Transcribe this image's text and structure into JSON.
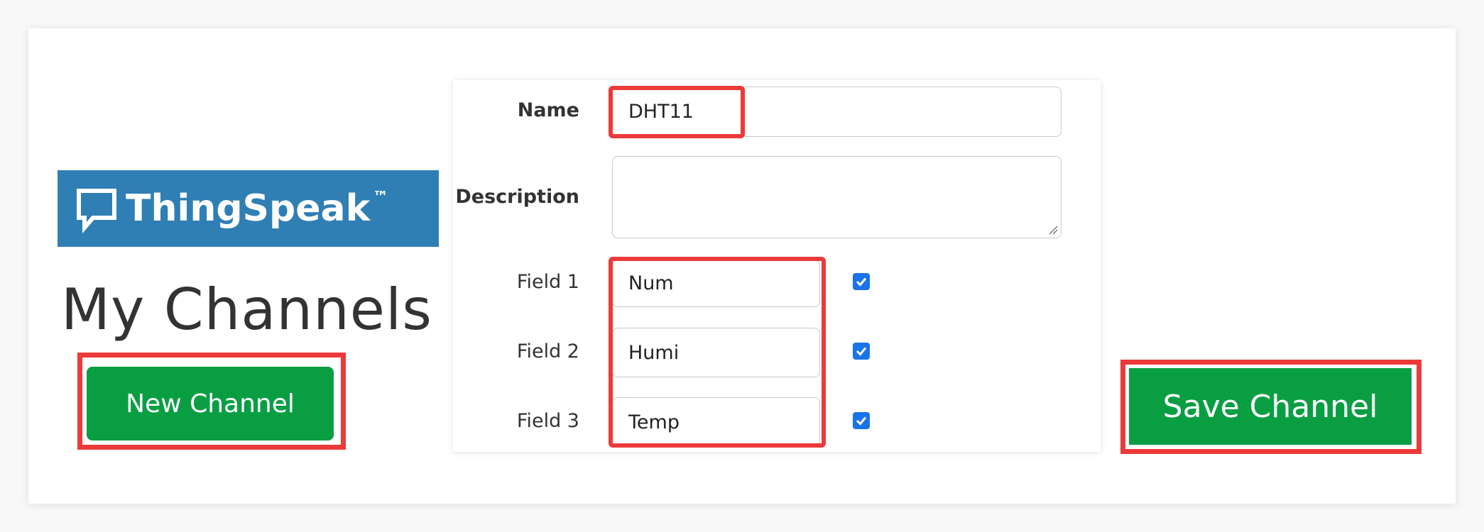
{
  "logo": {
    "brand": "ThingSpeak",
    "trademark": "™",
    "icon": "speech-bubble-icon",
    "background": "#2f7fb4"
  },
  "page": {
    "title": "My Channels"
  },
  "buttons": {
    "new_channel": "New Channel",
    "save_channel": "Save Channel",
    "color": "#0a9e43"
  },
  "form": {
    "name": {
      "label": "Name",
      "value": "DHT11"
    },
    "description": {
      "label": "Description",
      "value": ""
    },
    "fields": [
      {
        "label": "Field 1",
        "value": "Num",
        "checked": true
      },
      {
        "label": "Field 2",
        "value": "Humi",
        "checked": true
      },
      {
        "label": "Field 3",
        "value": "Temp",
        "checked": true
      }
    ]
  },
  "highlight_color": "#ec3a3a"
}
